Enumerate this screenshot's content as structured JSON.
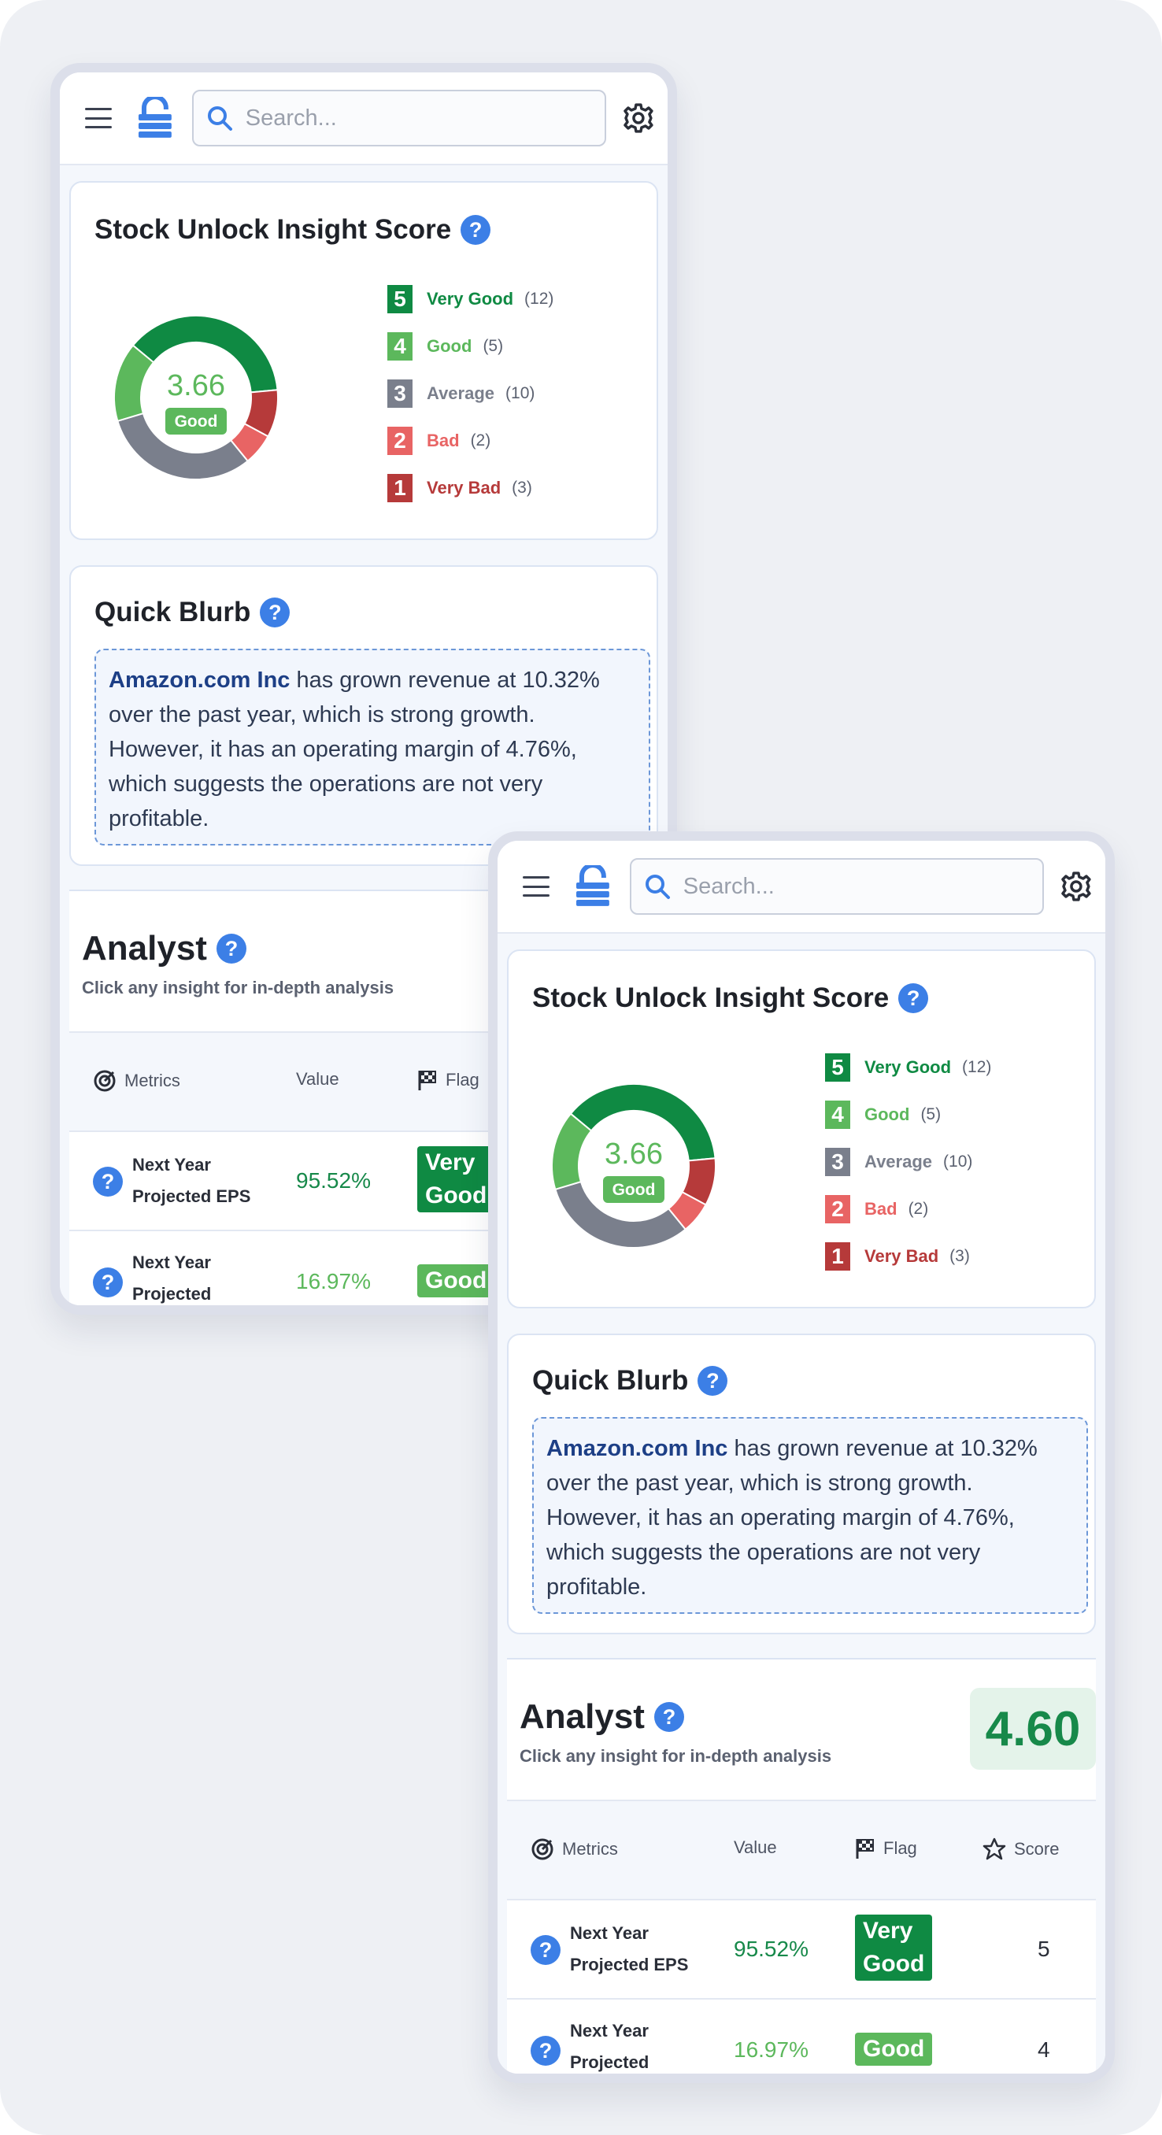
{
  "header": {
    "search_placeholder": "Search..."
  },
  "score_card": {
    "title": "Stock Unlock Insight Score",
    "help": "?",
    "score": "3.66",
    "score_label": "Good",
    "legend": [
      {
        "num": "5",
        "label": "Very Good",
        "count": "(12)",
        "color": "#0f8a43"
      },
      {
        "num": "4",
        "label": "Good",
        "count": "(5)",
        "color": "#5cb85c"
      },
      {
        "num": "3",
        "label": "Average",
        "count": "(10)",
        "color": "#7a7f8c"
      },
      {
        "num": "2",
        "label": "Bad",
        "count": "(2)",
        "color": "#e86464"
      },
      {
        "num": "1",
        "label": "Very Bad",
        "count": "(3)",
        "color": "#b63a3a"
      }
    ]
  },
  "blurb": {
    "title": "Quick Blurb",
    "help": "?",
    "company": "Amazon.com Inc",
    "text": " has grown revenue at 10.32% over the past year, which is strong growth. However, it has an operating margin of 4.76%, which suggests the operations are not very profitable."
  },
  "analyst": {
    "title": "Analyst",
    "help": "?",
    "subtitle": "Click any insight for in-depth analysis",
    "score": "4.60",
    "columns": {
      "metrics": "Metrics",
      "value": "Value",
      "flag": "Flag",
      "score": "Score"
    },
    "rows": [
      {
        "metric_line1": "Next Year",
        "metric_line2": "Projected EPS",
        "value": "95.52%",
        "flag_line1": "Very",
        "flag_line2": "Good",
        "score": "5",
        "value_color": "#17894a",
        "flag_color": "#0f8a43"
      },
      {
        "metric_line1": "Next Year",
        "metric_line2": "Projected",
        "value": "16.97%",
        "flag_line1": "Good",
        "flag_line2": "",
        "score": "4",
        "value_color": "#5cb85c",
        "flag_color": "#5cb85c"
      }
    ]
  }
}
